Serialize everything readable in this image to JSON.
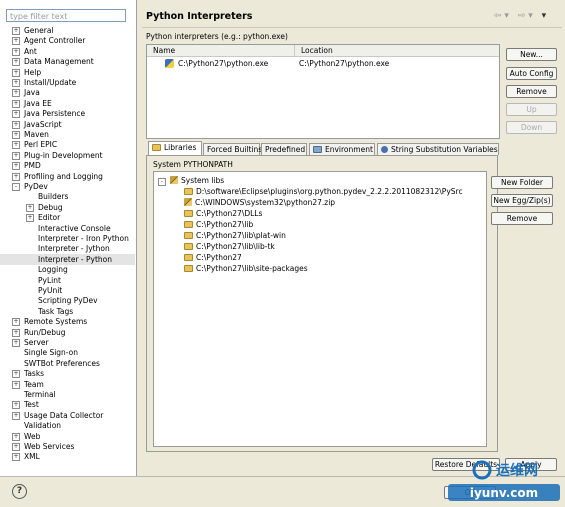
{
  "filter": {
    "placeholder": "type filter text"
  },
  "tree": [
    {
      "label": "General",
      "exp": "+"
    },
    {
      "label": "Agent Controller",
      "exp": "+"
    },
    {
      "label": "Ant",
      "exp": "+"
    },
    {
      "label": "Data Management",
      "exp": "+"
    },
    {
      "label": "Help",
      "exp": "+"
    },
    {
      "label": "Install/Update",
      "exp": "+"
    },
    {
      "label": "Java",
      "exp": "+"
    },
    {
      "label": "Java EE",
      "exp": "+"
    },
    {
      "label": "Java Persistence",
      "exp": "+"
    },
    {
      "label": "JavaScript",
      "exp": "+"
    },
    {
      "label": "Maven",
      "exp": "+"
    },
    {
      "label": "Perl EPIC",
      "exp": "+"
    },
    {
      "label": "Plug-in Development",
      "exp": "+"
    },
    {
      "label": "PMD",
      "exp": "+"
    },
    {
      "label": "Profiling and Logging",
      "exp": "+"
    },
    {
      "label": "PyDev",
      "exp": "-"
    },
    {
      "label": "Builders",
      "exp": "",
      "indent": 2
    },
    {
      "label": "Debug",
      "exp": "+",
      "indent": 1
    },
    {
      "label": "Editor",
      "exp": "+",
      "indent": 1
    },
    {
      "label": "Interactive Console",
      "exp": "",
      "indent": 2
    },
    {
      "label": "Interpreter - Iron Python",
      "exp": "",
      "indent": 2
    },
    {
      "label": "Interpreter - Jython",
      "exp": "",
      "indent": 2
    },
    {
      "label": "Interpreter - Python",
      "exp": "",
      "indent": 2,
      "selected": true
    },
    {
      "label": "Logging",
      "exp": "",
      "indent": 2
    },
    {
      "label": "PyLint",
      "exp": "",
      "indent": 2
    },
    {
      "label": "PyUnit",
      "exp": "",
      "indent": 2
    },
    {
      "label": "Scripting PyDev",
      "exp": "",
      "indent": 2
    },
    {
      "label": "Task Tags",
      "exp": "",
      "indent": 2
    },
    {
      "label": "Remote Systems",
      "exp": "+"
    },
    {
      "label": "Run/Debug",
      "exp": "+"
    },
    {
      "label": "Server",
      "exp": "+"
    },
    {
      "label": "Single Sign-on",
      "exp": ""
    },
    {
      "label": "SWTBot Preferences",
      "exp": ""
    },
    {
      "label": "Tasks",
      "exp": "+"
    },
    {
      "label": "Team",
      "exp": "+"
    },
    {
      "label": "Terminal",
      "exp": ""
    },
    {
      "label": "Test",
      "exp": "+"
    },
    {
      "label": "Usage Data Collector",
      "exp": "+"
    },
    {
      "label": "Validation",
      "exp": ""
    },
    {
      "label": "Web",
      "exp": "+"
    },
    {
      "label": "Web Services",
      "exp": "+"
    },
    {
      "label": "XML",
      "exp": "+"
    }
  ],
  "page": {
    "title": "Python Interpreters",
    "interpreters_label": "Python interpreters (e.g.: python.exe)",
    "col_name": "Name",
    "col_location": "Location",
    "interpreter_name": "C:\\Python27\\python.exe",
    "interpreter_location": "C:\\Python27\\python.exe",
    "nav_back": "⇦ ▾",
    "nav_fwd": "⇨ ▾",
    "nav_menu": "▾"
  },
  "buttons": {
    "new": "New...",
    "auto_config": "Auto Config",
    "remove": "Remove",
    "up": "Up",
    "down": "Down",
    "new_folder": "New Folder",
    "new_egg": "New Egg/Zip(s)",
    "remove_lib": "Remove",
    "restore": "Restore Defaults",
    "apply": "Apply",
    "ok": "OK"
  },
  "tabs": [
    "Libraries",
    "Forced Builtins",
    "Predefined",
    "Environment",
    "String Substitution Variables"
  ],
  "libs": {
    "label": "System PYTHONPATH",
    "root": "System libs",
    "items": [
      "D:\\software\\Eclipse\\plugins\\org.python.pydev_2.2.2.2011082312\\PySrc",
      "C:\\WINDOWS\\system32\\python27.zip",
      "C:\\Python27\\DLLs",
      "C:\\Python27\\lib",
      "C:\\Python27\\lib\\plat-win",
      "C:\\Python27\\lib\\lib-tk",
      "C:\\Python27",
      "C:\\Python27\\lib\\site-packages"
    ]
  },
  "help": {
    "symbol": "?"
  },
  "watermark": {
    "cn": "运维网",
    "domain": "iyunv.com"
  }
}
